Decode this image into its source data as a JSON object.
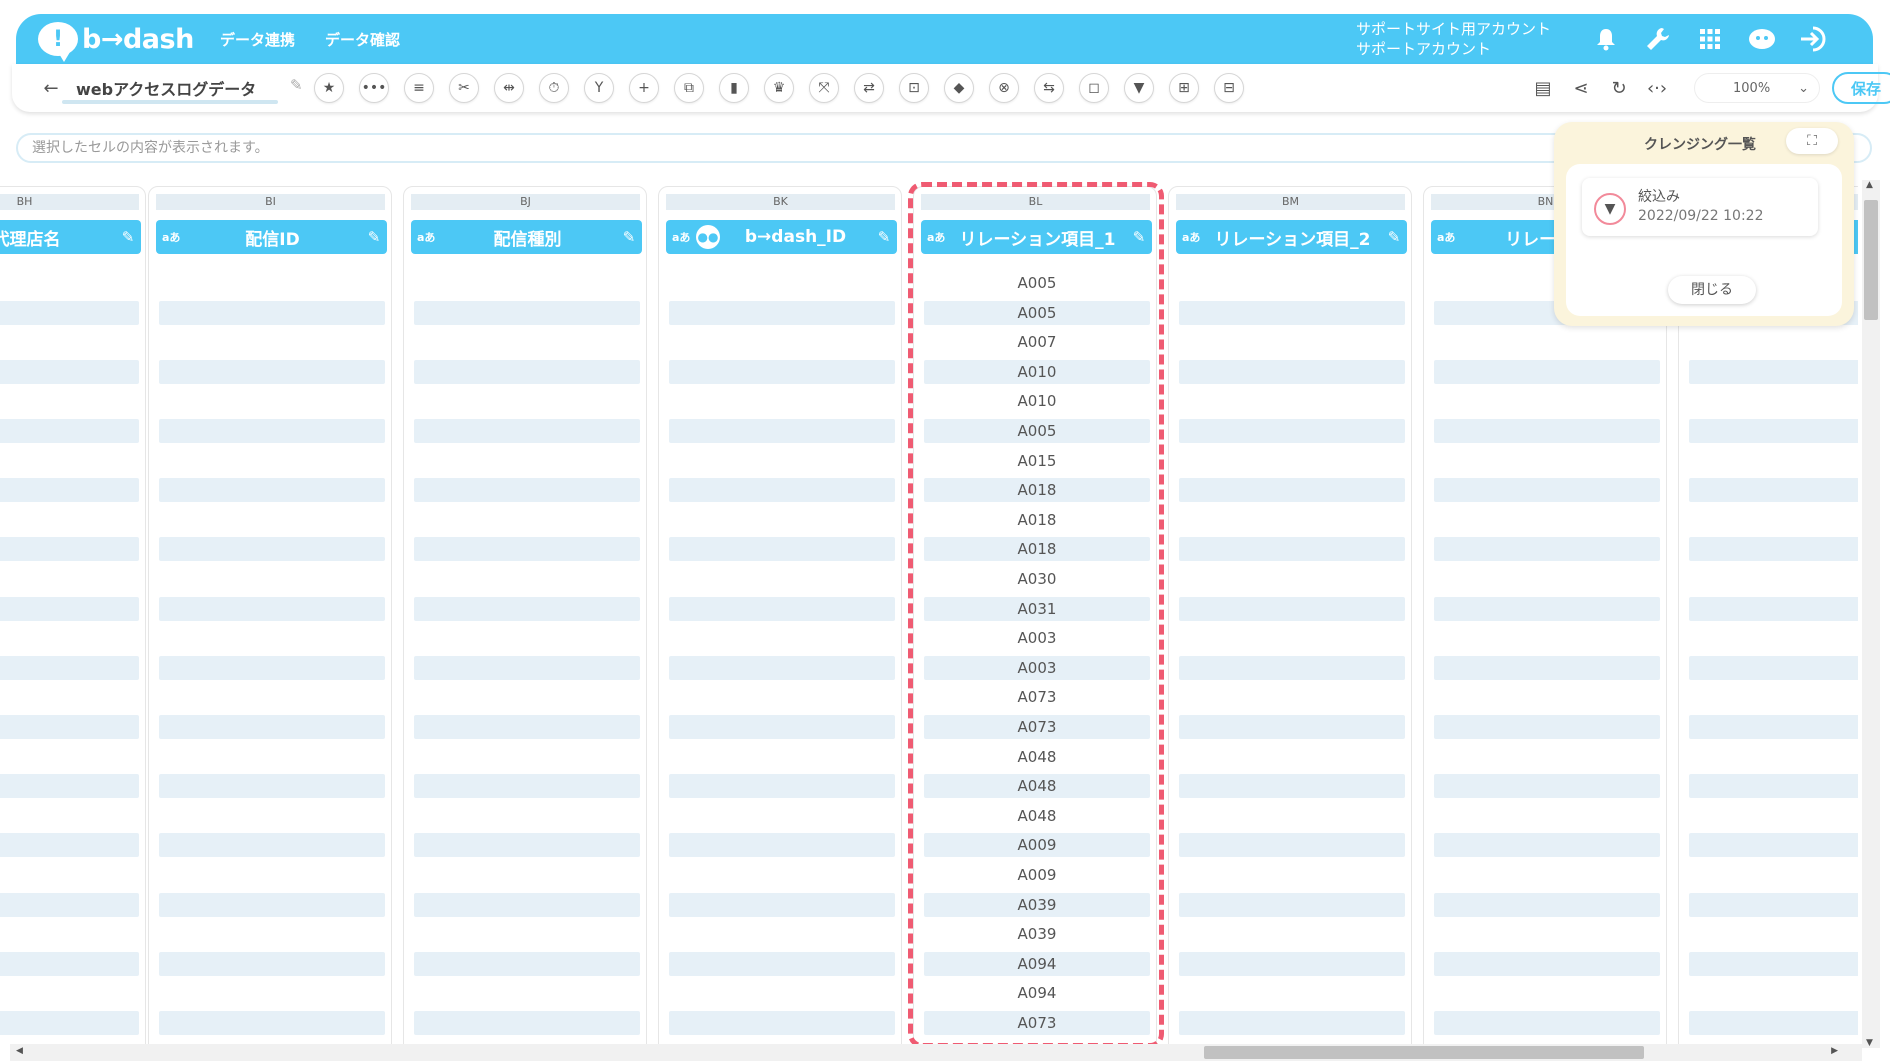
{
  "app": {
    "brand": "b→dash",
    "nav": [
      "データ連携",
      "データ確認"
    ],
    "account": [
      "サポートサイト用アカウント",
      "サポートアカウント"
    ]
  },
  "header_icons": [
    "bell-icon",
    "wrench-icon",
    "grid-icon",
    "bot-icon",
    "logout-icon"
  ],
  "toolbar": {
    "title": "webアクセスログデータ",
    "tools": [
      "star-icon",
      "more-icon",
      "list-icon",
      "cut-icon",
      "split-icon",
      "timer-icon",
      "merge-icon",
      "add-icon",
      "copy-icon",
      "trash-icon",
      "crown-icon",
      "expand-icon",
      "repeat-icon",
      "lock-icon",
      "bag-icon",
      "cancel-icon",
      "convert-icon",
      "box-icon",
      "filter-icon",
      "pivot-icon",
      "table-icon"
    ],
    "right_tools": [
      "clipboard-icon",
      "share-icon",
      "refresh-icon",
      "code-icon"
    ],
    "zoom": "100%",
    "save_label": "保存"
  },
  "cellbar": {
    "placeholder": "選択したセルの内容が表示されます。"
  },
  "columns": [
    {
      "letter": "BH",
      "badge": "",
      "name": "代理店名"
    },
    {
      "letter": "BI",
      "badge": "aあ",
      "name": "配信ID"
    },
    {
      "letter": "BJ",
      "badge": "aあ",
      "name": "配信種別"
    },
    {
      "letter": "BK",
      "badge": "aあ",
      "name": "b→dash_ID"
    },
    {
      "letter": "BL",
      "badge": "aあ",
      "name": "リレーション項目_1"
    },
    {
      "letter": "BM",
      "badge": "aあ",
      "name": "リレーション項目_2"
    },
    {
      "letter": "BN",
      "badge": "aあ",
      "name": "リレーショ"
    },
    {
      "letter": "",
      "badge": "",
      "name": ""
    }
  ],
  "bl_values": [
    "A005",
    "A005",
    "A007",
    "A010",
    "A010",
    "A005",
    "A015",
    "A018",
    "A018",
    "A018",
    "A030",
    "A031",
    "A003",
    "A003",
    "A073",
    "A073",
    "A048",
    "A048",
    "A048",
    "A009",
    "A009",
    "A039",
    "A039",
    "A094",
    "A094",
    "A073"
  ],
  "panel": {
    "title": "クレンジング一覧",
    "item_label": "絞込み",
    "item_date": "2022/09/22 10:22",
    "close_label": "閉じる"
  },
  "colors": {
    "primary": "#4cc8f5",
    "highlight": "#ef5b72",
    "stripe": "#e6f0f7",
    "panel_bg": "#fbf4dc"
  }
}
